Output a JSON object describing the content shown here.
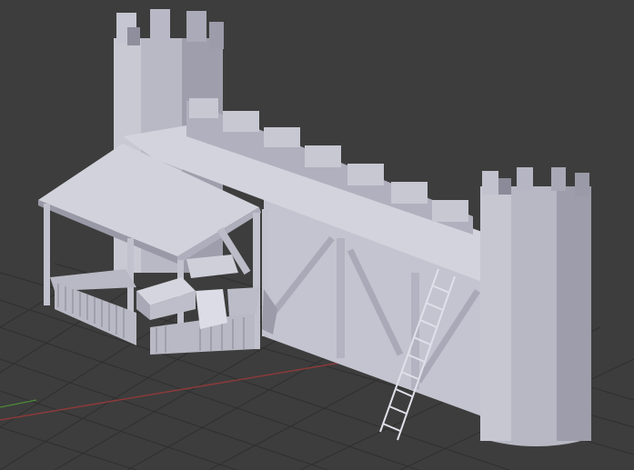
{
  "viewport": {
    "background": "#3d3d3d",
    "grid_color": "#2e2e2e",
    "x_axis_color": "#8a3a3a",
    "y_axis_color": "#4d8a3a",
    "model_light": "#d6d6e0",
    "model_mid": "#b9b9c6",
    "model_dark": "#8e8e9c",
    "model_shadow": "#6f6f7c"
  },
  "scene": {
    "objects": [
      "castle-wall",
      "left-tower",
      "right-tower",
      "roofed-shed",
      "fence",
      "crates",
      "ladder"
    ]
  }
}
